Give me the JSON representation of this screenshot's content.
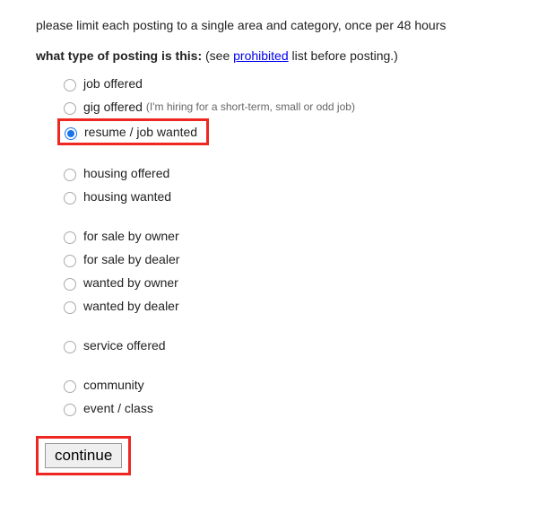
{
  "intro_text": "please limit each posting to a single area and category, once per 48 hours",
  "prompt_bold": "what type of posting is this:",
  "prompt_rest_before": " (see ",
  "prompt_link": "prohibited",
  "prompt_rest_after": " list before posting.)",
  "groups": [
    {
      "items": [
        {
          "label": "job offered",
          "hint": "",
          "selected": false
        },
        {
          "label": "gig offered",
          "hint": "(I'm hiring for a short-term, small or odd job)",
          "selected": false
        },
        {
          "label": "resume / job wanted",
          "hint": "",
          "selected": true,
          "highlight": true
        }
      ]
    },
    {
      "items": [
        {
          "label": "housing offered",
          "hint": "",
          "selected": false
        },
        {
          "label": "housing wanted",
          "hint": "",
          "selected": false
        }
      ]
    },
    {
      "items": [
        {
          "label": "for sale by owner",
          "hint": "",
          "selected": false
        },
        {
          "label": "for sale by dealer",
          "hint": "",
          "selected": false
        },
        {
          "label": "wanted by owner",
          "hint": "",
          "selected": false
        },
        {
          "label": "wanted by dealer",
          "hint": "",
          "selected": false
        }
      ]
    },
    {
      "items": [
        {
          "label": "service offered",
          "hint": "",
          "selected": false
        }
      ]
    },
    {
      "items": [
        {
          "label": "community",
          "hint": "",
          "selected": false
        },
        {
          "label": "event / class",
          "hint": "",
          "selected": false
        }
      ]
    }
  ],
  "continue_label": "continue"
}
